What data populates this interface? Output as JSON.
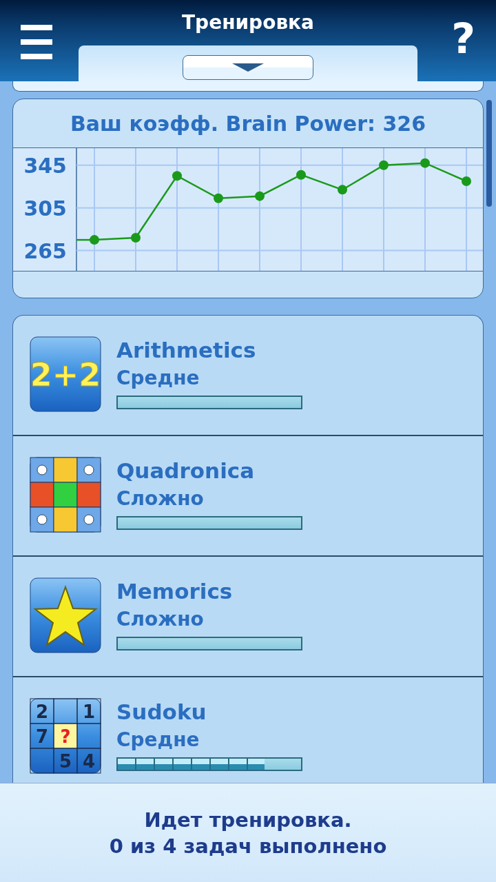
{
  "header": {
    "title": "Тренировка",
    "help_label": "?"
  },
  "score": {
    "title": "Ваш коэфф. Brain Power: 326",
    "chart_data": {
      "type": "line",
      "grid": true,
      "categories": [
        null,
        null,
        null,
        null,
        null,
        null,
        null,
        null,
        null,
        null
      ],
      "ylim": [
        246,
        361
      ],
      "yticks": [
        {
          "value": 265,
          "label": "265"
        },
        {
          "value": 305,
          "label": "305"
        },
        {
          "value": 345,
          "label": "345"
        }
      ],
      "series": [
        {
          "color": "#1a9a1a",
          "marker": "circle",
          "values": [
            275,
            277,
            335,
            314,
            316,
            336,
            322,
            345,
            347,
            330
          ]
        }
      ]
    }
  },
  "tasks": [
    {
      "kind": "arithmetic",
      "icon_text": [
        "2+2"
      ],
      "name": "Arithmetics",
      "difficulty": "Средне",
      "level": 0
    },
    {
      "kind": "quadronica",
      "name": "Quadronica",
      "difficulty": "Сложно",
      "level": 0
    },
    {
      "kind": "memorics",
      "name": "Memorics",
      "difficulty": "Сложно",
      "level": 0
    },
    {
      "kind": "sudoku",
      "icon_text": [
        "2",
        "1",
        "7",
        "?",
        "5",
        "4"
      ],
      "name": "Sudoku",
      "difficulty": "Средне",
      "level": 0.8
    }
  ],
  "status": {
    "lines": [
      "Идет тренировка.",
      "0 из 4 задач выполнено"
    ]
  }
}
